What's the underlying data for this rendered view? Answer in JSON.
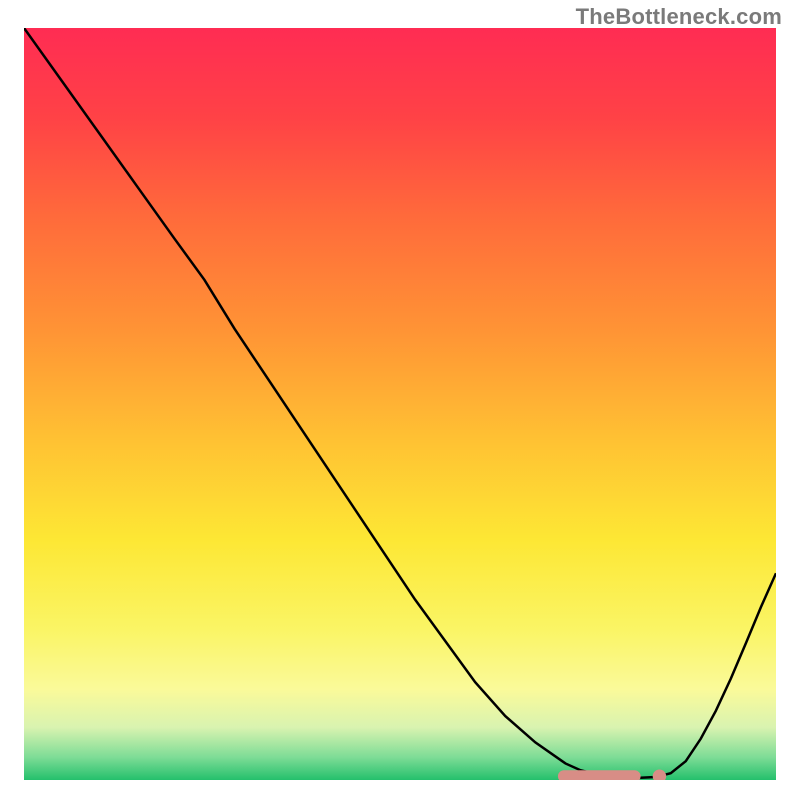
{
  "watermark": "TheBottleneck.com",
  "chart_data": {
    "type": "line",
    "title": "",
    "xlabel": "",
    "ylabel": "",
    "xlim": [
      0,
      100
    ],
    "ylim": [
      0,
      100
    ],
    "grid": false,
    "background": {
      "type": "vertical-gradient",
      "stops": [
        {
          "offset": 0.0,
          "color": "#ff2c53"
        },
        {
          "offset": 0.12,
          "color": "#ff4246"
        },
        {
          "offset": 0.25,
          "color": "#ff6a3b"
        },
        {
          "offset": 0.4,
          "color": "#ff9335"
        },
        {
          "offset": 0.55,
          "color": "#ffc233"
        },
        {
          "offset": 0.68,
          "color": "#fde734"
        },
        {
          "offset": 0.8,
          "color": "#faf565"
        },
        {
          "offset": 0.88,
          "color": "#fafa9a"
        },
        {
          "offset": 0.93,
          "color": "#d9f3b0"
        },
        {
          "offset": 0.97,
          "color": "#7ddc96"
        },
        {
          "offset": 1.0,
          "color": "#24c06c"
        }
      ]
    },
    "series": [
      {
        "name": "bottleneck-curve",
        "color": "#000000",
        "x": [
          0.0,
          5,
          10,
          15,
          20,
          24,
          28,
          32,
          36,
          40,
          44,
          48,
          52,
          56,
          60,
          64,
          68,
          72,
          74,
          76,
          78,
          80,
          82,
          84,
          86,
          88,
          90,
          92,
          94,
          96,
          98,
          100
        ],
        "y": [
          100,
          93,
          86,
          79,
          72,
          66.5,
          60,
          54,
          48,
          42,
          36,
          30,
          24,
          18.5,
          13,
          8.5,
          5,
          2.2,
          1.3,
          0.8,
          0.5,
          0.35,
          0.3,
          0.4,
          0.9,
          2.5,
          5.5,
          9.2,
          13.5,
          18.2,
          23,
          27.5
        ]
      }
    ],
    "markers": [
      {
        "name": "optimal-zone",
        "type": "pill",
        "color": "#d88d86",
        "x_start": 71,
        "x_end": 82,
        "y": 0.5,
        "height_pct": 1.6
      },
      {
        "name": "optimal-point",
        "type": "dot",
        "color": "#d88d86",
        "x": 84.5,
        "y": 0.5,
        "r_pct": 0.9
      }
    ]
  }
}
